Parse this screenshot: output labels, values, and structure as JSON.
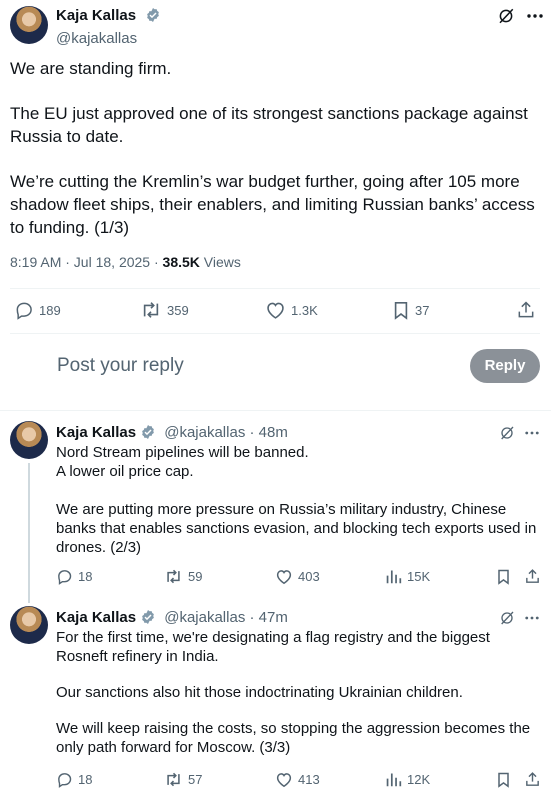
{
  "main_tweet": {
    "author_name": "Kaja Kallas",
    "author_handle": "@kajakallas",
    "paragraphs": [
      "We are standing firm.",
      "The EU just approved one of its strongest sanctions package against Russia to date.",
      "We’re cutting the Kremlin’s war budget further, going after 105 more shadow fleet ships, their enablers, and limiting Russian banks’ access to funding. (1/3)"
    ],
    "timestamp": "8:19 AM · Jul 18, 2025",
    "views_sep": " · ",
    "views_count": "38.5K",
    "views_label": "Views",
    "stats": {
      "replies": "189",
      "reposts": "359",
      "likes": "1.3K",
      "bookmarks": "37"
    }
  },
  "reply_box": {
    "placeholder": "Post your reply",
    "button_label": "Reply"
  },
  "thread": [
    {
      "author_name": "Kaja Kallas",
      "author_handle": "@kajakallas",
      "time": "· 48m",
      "paragraphs": [
        "Nord Stream pipelines will be banned.\nA lower oil price cap.",
        "We are putting more pressure on Russia’s military industry, Chinese banks that enables sanctions evasion, and blocking tech exports used in drones. (2/3)"
      ],
      "stats": {
        "replies": "18",
        "reposts": "59",
        "likes": "403",
        "views": "15K"
      }
    },
    {
      "author_name": "Kaja Kallas",
      "author_handle": "@kajakallas",
      "time": "· 47m",
      "paragraphs": [
        "For the first time, we're designating a flag registry and the biggest Rosneft refinery in India.",
        "Our sanctions also hit those indoctrinating Ukrainian children.",
        "We will keep raising the costs, so stopping the aggression becomes the only path forward for Moscow. (3/3)"
      ],
      "stats": {
        "replies": "18",
        "reposts": "57",
        "likes": "413",
        "views": "12K"
      }
    }
  ],
  "colors": {
    "text": "#0f1419",
    "secondary": "#536471",
    "reply_button_bg": "#8b9198",
    "divider": "#eff3f4"
  },
  "icons": [
    "verified-badge-icon",
    "grok-icon",
    "more-icon",
    "reply-icon",
    "repost-icon",
    "like-icon",
    "bookmark-icon",
    "share-icon",
    "views-icon"
  ]
}
